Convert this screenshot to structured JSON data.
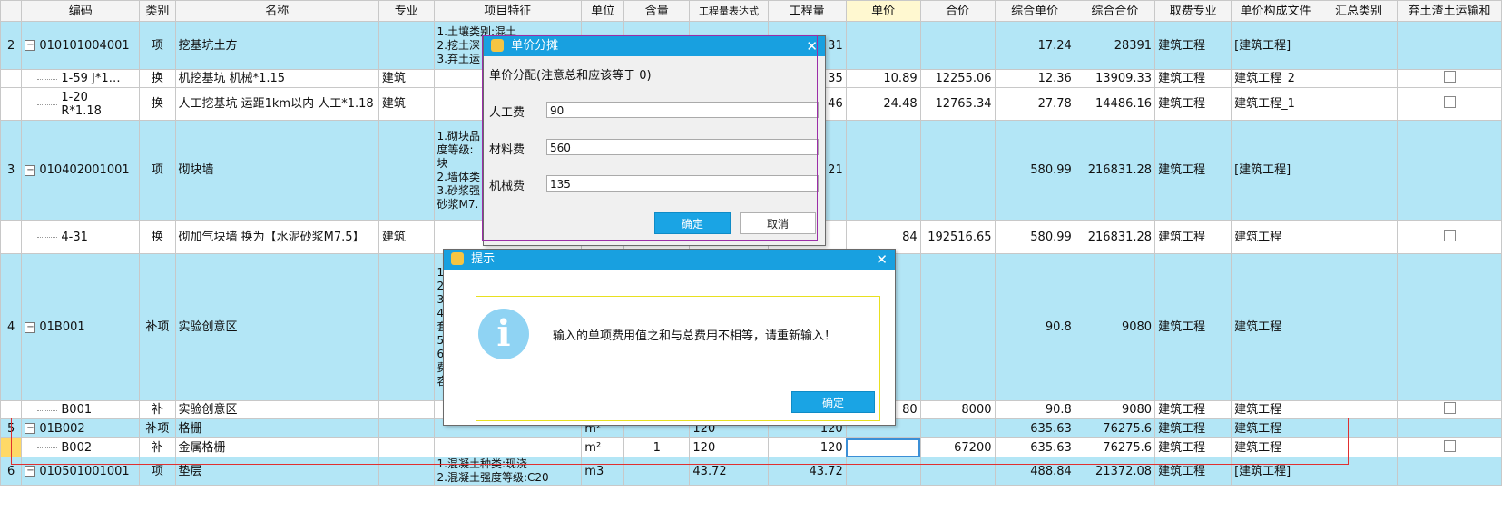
{
  "columns": [
    "编码",
    "类别",
    "名称",
    "专业",
    "项目特征",
    "单位",
    "含量",
    "工程量表达式",
    "工程量",
    "单价",
    "合价",
    "综合单价",
    "综合合价",
    "取费专业",
    "单价构成文件",
    "汇总类别",
    "弃土渣土运输和"
  ],
  "rows": [
    {
      "idx": "2",
      "code": "010101004001",
      "cat": "项",
      "name": "挖基坑土方",
      "major": "",
      "feat": "1.土壤类别:混土\n2.挖土深\n3.弃土运",
      "unit": "",
      "qty": "",
      "expr": "",
      "amt": "31",
      "price": "",
      "total": "",
      "cprice": "17.24",
      "ctotal": "28391",
      "fee": "建筑工程",
      "file": "[建筑工程]",
      "sum": "",
      "chk": false
    },
    {
      "idx": "",
      "code": "1-59 J*1…",
      "cat": "换",
      "name": "机挖基坑  机械*1.15",
      "major": "建筑",
      "feat": "",
      "unit": "",
      "qty": "",
      "expr": "",
      "amt": "35",
      "price": "10.89",
      "total": "12255.06",
      "cprice": "12.36",
      "ctotal": "13909.33",
      "fee": "建筑工程",
      "file": "建筑工程_2",
      "sum": "",
      "chk": true
    },
    {
      "idx": "",
      "code": "1-20\nR*1.18",
      "cat": "换",
      "name": "人工挖基坑 运距1km以内  人工*1.18",
      "major": "建筑",
      "feat": "",
      "unit": "",
      "qty": "",
      "expr": "",
      "amt": "46",
      "price": "24.48",
      "total": "12765.34",
      "cprice": "27.78",
      "ctotal": "14486.16",
      "fee": "建筑工程",
      "file": "建筑工程_1",
      "sum": "",
      "chk": true
    },
    {
      "idx": "3",
      "code": "010402001001",
      "cat": "项",
      "name": "砌块墙",
      "major": "",
      "feat": "1.砌块品\n度等级:\n块\n2.墙体类\n3.砂浆强\n砂浆M7.",
      "unit": "",
      "qty": "",
      "expr": "",
      "amt": "21",
      "price": "",
      "total": "",
      "cprice": "580.99",
      "ctotal": "216831.28",
      "fee": "建筑工程",
      "file": "[建筑工程]",
      "sum": "",
      "chk": false
    },
    {
      "idx": "",
      "code": "4-31",
      "cat": "换",
      "name": "砌加气块墙  换为【水泥砂浆M7.5】",
      "major": "建筑",
      "feat": "",
      "unit": "",
      "qty": "",
      "expr": "",
      "amt": "",
      "price": "84",
      "total": "192516.65",
      "cprice": "580.99",
      "ctotal": "216831.28",
      "fee": "建筑工程",
      "file": "建筑工程",
      "sum": "",
      "chk": true
    },
    {
      "idx": "4",
      "code": "01B001",
      "cat": "补项",
      "name": "实验创意区",
      "major": "",
      "feat": "1.\n2.\n3.\n4.\n套\n5.\n6.\n费\n容",
      "unit": "",
      "qty": "",
      "expr": "",
      "amt": "",
      "price": "",
      "total": "",
      "cprice": "90.8",
      "ctotal": "9080",
      "fee": "建筑工程",
      "file": "建筑工程",
      "sum": "",
      "chk": false
    },
    {
      "idx": "",
      "code": "B001",
      "cat": "补",
      "name": "实验创意区",
      "major": "",
      "feat": "",
      "unit": "m2",
      "qty": "1",
      "expr": "100",
      "amt": "100",
      "price": "80",
      "total": "8000",
      "cprice": "90.8",
      "ctotal": "9080",
      "fee": "建筑工程",
      "file": "建筑工程",
      "sum": "",
      "chk": true
    },
    {
      "idx": "5",
      "code": "01B002",
      "cat": "补项",
      "name": "格栅",
      "major": "",
      "feat": "",
      "unit": "m²",
      "qty": "",
      "expr": "120",
      "amt": "120",
      "price": "",
      "total": "",
      "cprice": "635.63",
      "ctotal": "76275.6",
      "fee": "建筑工程",
      "file": "建筑工程",
      "sum": "",
      "chk": false
    },
    {
      "idx": "",
      "code": "B002",
      "cat": "补",
      "name": "金属格栅",
      "major": "",
      "feat": "",
      "unit": "m²",
      "qty": "1",
      "expr": "120",
      "amt": "120",
      "price": "",
      "total": "67200",
      "cprice": "635.63",
      "ctotal": "76275.6",
      "fee": "建筑工程",
      "file": "建筑工程",
      "sum": "",
      "chk": true
    },
    {
      "idx": "6",
      "code": "010501001001",
      "cat": "项",
      "name": "垫层",
      "major": "",
      "feat": "1.混凝土种类:现浇\n2.混凝土强度等级:C20",
      "unit": "m3",
      "qty": "",
      "expr": "43.72",
      "amt": "43.72",
      "price": "",
      "total": "",
      "cprice": "488.84",
      "ctotal": "21372.08",
      "fee": "建筑工程",
      "file": "[建筑工程]",
      "sum": "",
      "chk": false
    }
  ],
  "dialog1": {
    "title": "单价分摊",
    "hint": "单价分配(注意总和应该等于 0)",
    "labor_label": "人工费",
    "labor_value": "90",
    "material_label": "材料费",
    "material_value": "560",
    "machine_label": "机械费",
    "machine_value": "135",
    "ok": "确定",
    "cancel": "取消"
  },
  "dialog2": {
    "title": "提示",
    "message": "输入的单项费用值之和与总费用不相等，请重新输入！",
    "ok": "确定"
  }
}
